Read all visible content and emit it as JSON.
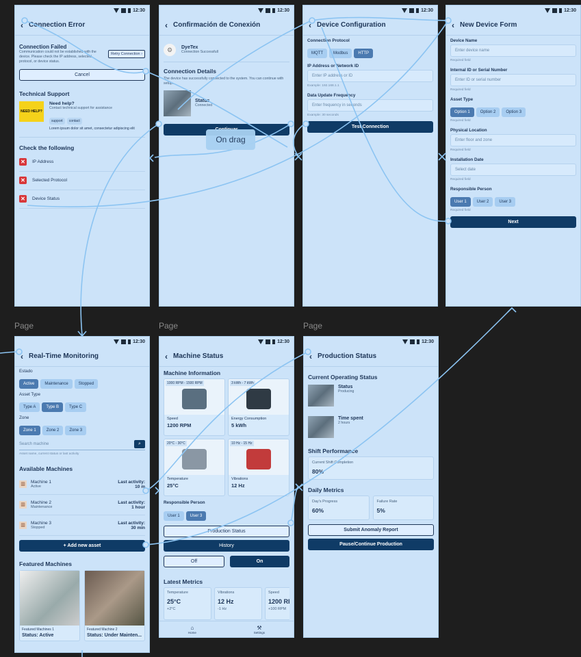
{
  "status_time": "12:30",
  "page_labels": [
    "Page",
    "Page",
    "Page"
  ],
  "drag_label": "On drag",
  "s1": {
    "title": "Connection Error",
    "failed_title": "Connection Failed",
    "failed_desc": "Communication could not be established with the device. Please check the IP address, selected protocol, or device status.",
    "retry": "Retry Connection",
    "cancel": "Cancel",
    "support_title": "Technical Support",
    "help_title": "Need help?",
    "help_desc": "Contact technical support for assistance",
    "tags": [
      "support",
      "contact"
    ],
    "lorem": "Lorem ipsum dolor sit amet, consectetur adipiscing elit",
    "check_title": "Check the following",
    "checks": [
      "IP Address",
      "Selected Protocol",
      "Device Status"
    ]
  },
  "s2": {
    "title": "Confirmación de Conexión",
    "brand": "DyeTex",
    "brand_sub": "Connection Successfull",
    "details_title": "Connection Details",
    "details_desc": "The device has successfully connected to the system. You can continue with setup.",
    "status_label": "Status",
    "status_value": "Connected",
    "continue": "Continuar"
  },
  "s3": {
    "title": "Device Configuration",
    "protocol_label": "Connection Protocol",
    "protocols": [
      "MQTT",
      "Modbus",
      "HTTP"
    ],
    "ip_label": "IP Address or Network ID",
    "ip_placeholder": "Enter IP address or ID",
    "ip_example": "Example: 192.168.1.1",
    "freq_label": "Data Update Frequency",
    "freq_placeholder": "Enter frequency in seconds",
    "freq_example": "Example: 30 seconds",
    "test": "Test Connection"
  },
  "s4": {
    "title": "New Device Form",
    "name_label": "Device Name",
    "name_ph": "Enter device name",
    "id_label": "Internal ID or Serial Number",
    "id_ph": "Enter ID or serial number",
    "type_label": "Asset Type",
    "types": [
      "Option 1",
      "Option 2",
      "Option 3"
    ],
    "loc_label": "Physical Location",
    "loc_ph": "Enter floor and zone",
    "date_label": "Installation Date",
    "date_ph": "Select date",
    "person_label": "Responsible Person",
    "persons": [
      "User 1",
      "User 2",
      "User 3"
    ],
    "required": "Required field",
    "next": "Next"
  },
  "s5": {
    "title": "Real-Time Monitoring",
    "estado_label": "Estado",
    "estados": [
      "Active",
      "Maintenance",
      "Stopped"
    ],
    "asset_label": "Asset Type",
    "assets": [
      "Type A",
      "Type B",
      "Type C"
    ],
    "zone_label": "Zone",
    "zones": [
      "Zone 1",
      "Zone 2",
      "Zone 3"
    ],
    "search_ph": "Search machine",
    "search_hint": "Asset name, current status or last activity",
    "avail_title": "Available Machines",
    "machines": [
      {
        "name": "Machine 1",
        "status": "Active",
        "act_label": "Last activity:",
        "act": "10 m"
      },
      {
        "name": "Machine 2",
        "status": "Maintenance",
        "act_label": "Last activity:",
        "act": "1 hour"
      },
      {
        "name": "Machine 3",
        "status": "Stopped",
        "act_label": "Last activity:",
        "act": "30 min"
      }
    ],
    "add": "+ Add new asset",
    "featured_title": "Featured Machines",
    "featured": [
      {
        "cap": "Featured Machines 1",
        "status": "Status: Active"
      },
      {
        "cap": "Featured Machine 2",
        "status": "Status: Under Mainten..."
      }
    ]
  },
  "s6": {
    "title": "Machine Status",
    "info_title": "Machine Information",
    "cards": [
      {
        "range": "1000 RPM - 1500 RPM",
        "label": "Speed",
        "value": "1200 RPM"
      },
      {
        "range": "3 kWh - 7 kWh",
        "label": "Energy Consumption",
        "value": "5 kWh"
      },
      {
        "range": "20°C - 30°C",
        "label": "Temperature",
        "value": "25°C"
      },
      {
        "range": "10 Hz - 15 Hz",
        "label": "Vibrations",
        "value": "12 Hz"
      }
    ],
    "person_label": "Responsible Person",
    "persons": [
      "User 1",
      "User 3"
    ],
    "prod_status": "Production Status",
    "history": "History",
    "off": "Off",
    "on": "On",
    "latest_title": "Latest Metrics",
    "metrics": [
      {
        "label": "Temperature",
        "value": "25°C",
        "delta": "+2°C"
      },
      {
        "label": "Vibrations",
        "value": "12 Hz",
        "delta": "-1 Hz"
      },
      {
        "label": "Speed",
        "value": "1200 RPM",
        "delta": "+100 RPM"
      }
    ],
    "nav": [
      "Home",
      "Settings"
    ]
  },
  "s7": {
    "title": "Production Status",
    "current_title": "Current Operating Status",
    "status_label": "Status",
    "status_value": "Producing",
    "time_label": "Time spent",
    "time_value": "2 hours",
    "shift_title": "Shift Performance",
    "shift_label": "Current Shift Completion",
    "shift_value": "80%",
    "daily_title": "Daily Metrics",
    "daily": [
      {
        "label": "Day's Progress",
        "value": "60%"
      },
      {
        "label": "Failure Rate",
        "value": "5%"
      }
    ],
    "submit": "Submit Anomaly Report",
    "pause": "Pause/Continue Production"
  }
}
